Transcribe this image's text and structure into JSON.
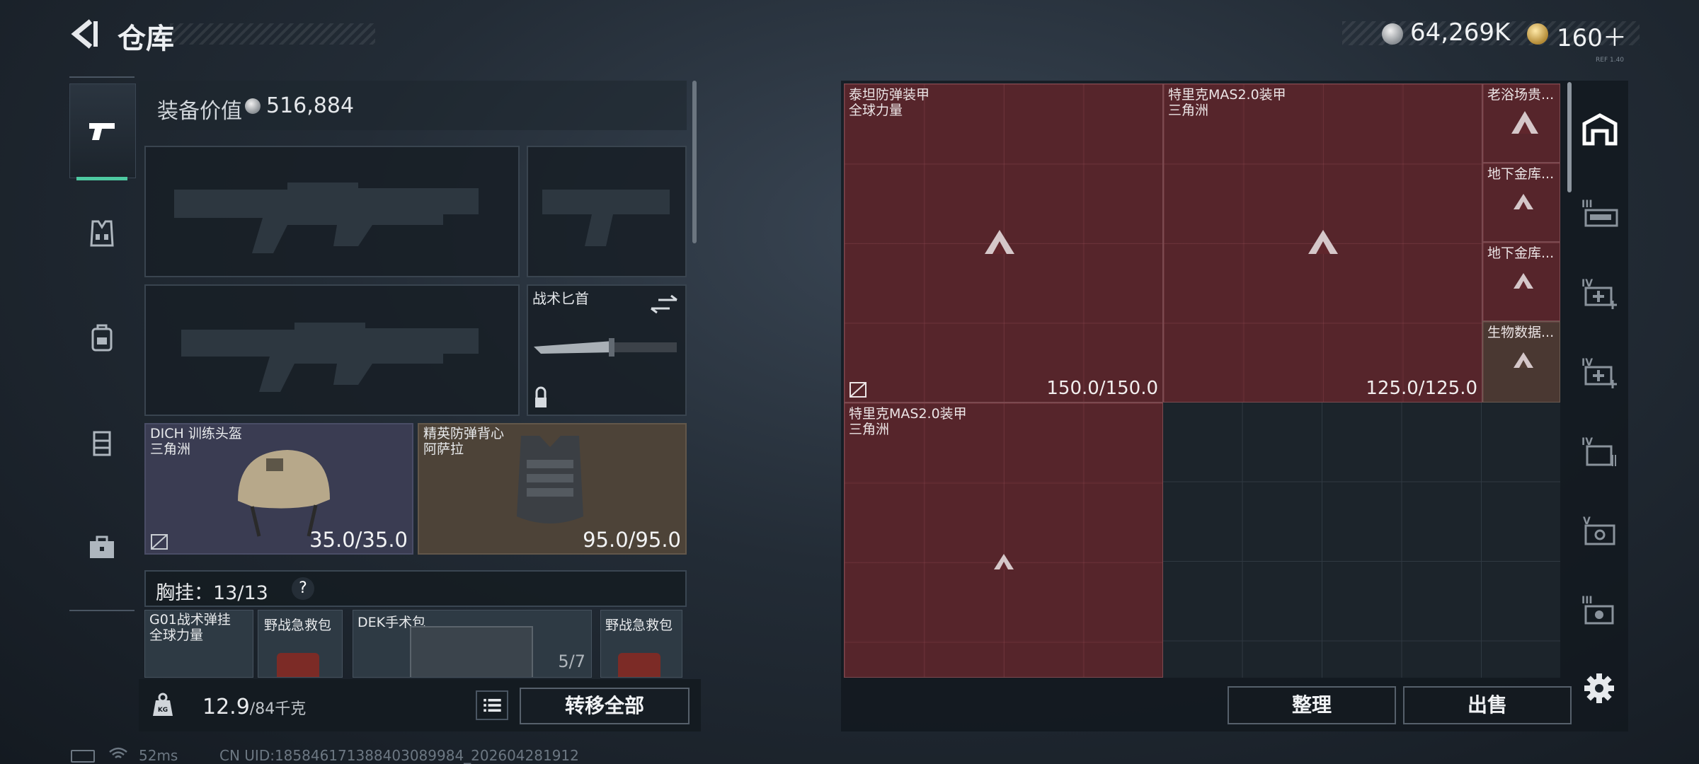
{
  "header": {
    "title": "仓库",
    "currency_silver": "64,269K",
    "currency_gold": "160＋",
    "watermark": "REF 1.40"
  },
  "categories": [
    {
      "name": "firearms",
      "icon": "pistol-icon",
      "selected": true
    },
    {
      "name": "armor",
      "icon": "vest-icon"
    },
    {
      "name": "backpack",
      "icon": "backpack-icon"
    },
    {
      "name": "rig",
      "icon": "chest-rig-icon"
    },
    {
      "name": "supplies",
      "icon": "toolbox-icon"
    }
  ],
  "loadout": {
    "value_label": "装备价值",
    "value": "516,884",
    "knife_label": "战术匕首",
    "helmet": {
      "name": "DICH 训练头盔",
      "maker": "三角洲",
      "durability": "35.0/35.0"
    },
    "vest": {
      "name": "精英防弹背心",
      "maker": "阿萨拉",
      "durability": "95.0/95.0"
    },
    "rig_label": "胸挂：",
    "rig_count": "13/13",
    "rig_help": "?",
    "rig_items": [
      {
        "name": "G01战术弹挂",
        "maker": "全球力量"
      },
      {
        "name": "野战急救包",
        "maker": ""
      },
      {
        "name": "DEK手术包",
        "maker": "",
        "count": "5/7"
      },
      {
        "name": "野战急救包",
        "maker": ""
      }
    ]
  },
  "bottom": {
    "weight": "12.9",
    "weight_unit": "/84千克",
    "transfer_all": "转移全部",
    "ping": "52ms",
    "uid": "CN UID:18584617138840308998​4_202604281912"
  },
  "storage": {
    "items": [
      {
        "name": "泰坦防弹装甲",
        "maker": "全球力量",
        "durability": "150.0/150.0"
      },
      {
        "name": "特里克MAS2.0装甲",
        "maker": "三角洲",
        "durability": "125.0/125.0"
      },
      {
        "name": "老浴场贵...",
        "maker": ""
      },
      {
        "name": "地下金库...",
        "maker": ""
      },
      {
        "name": "地下金库...",
        "maker": ""
      },
      {
        "name": "生物数据...",
        "maker": ""
      },
      {
        "name": "特里克MAS2.0装甲",
        "maker": "三角洲",
        "durability": ""
      }
    ],
    "sort": "整理",
    "sell": "出售"
  },
  "storage_tabs": [
    {
      "icon": "warehouse-icon",
      "selected": true
    },
    {
      "icon": "gun-case-icon",
      "tier": "III"
    },
    {
      "icon": "medical-box-icon",
      "tier": "IV"
    },
    {
      "icon": "medical-box-icon",
      "tier": "IV"
    },
    {
      "icon": "document-case-icon",
      "tier": "IV"
    },
    {
      "icon": "safe-icon",
      "tier": "V"
    },
    {
      "icon": "camera-case-icon",
      "tier": "III"
    }
  ],
  "colors": {
    "accent": "#4ec9a1",
    "item_red": "#60262c",
    "helmet_bg": "#3a3c52",
    "vest_bg": "#4d4338"
  }
}
